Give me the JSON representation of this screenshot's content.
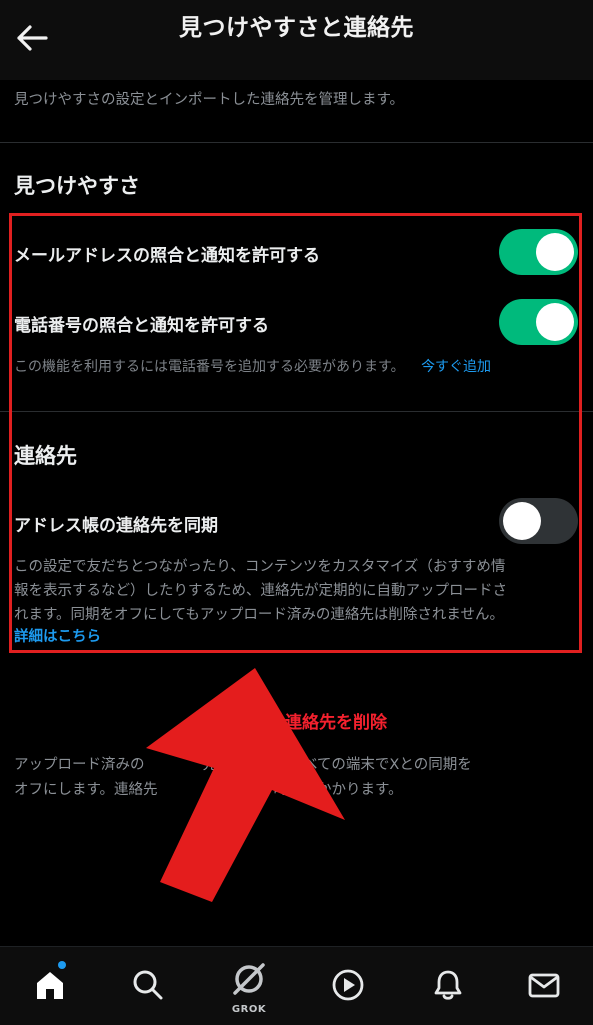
{
  "header": {
    "title": "見つけやすさと連絡先",
    "back_icon": "arrow-left-icon"
  },
  "intro": "見つけやすさの設定とインポートした連絡先を管理します。",
  "discoverability": {
    "heading": "見つけやすさ",
    "email_label": "メールアドレスの照合と通知を許可する",
    "email_enabled": true,
    "phone_label": "電話番号の照合と通知を許可する",
    "phone_enabled": true,
    "phone_note": "この機能を利用するには電話番号を追加する必要があります。",
    "add_now_link": "今すぐ追加"
  },
  "contacts": {
    "heading": "連絡先",
    "sync_label": "アドレス帳の連絡先を同期",
    "sync_enabled": false,
    "sync_lines": [
      "この設定で友だちとつながったり、コンテンツをカスタマイズ（おすすめ情",
      "報を表示するなど）したりするため、連絡先が定期的に自動アップロードさ",
      "れます。同期をオフにしてもアップロード済みの連絡先は削除されません。"
    ],
    "details_link": "詳細はこちら",
    "delete_label_visible": "の連絡先を削除",
    "delete_desc_lines": [
      "アップロード済みの　　　　先を削除し、すべての端末でXとの同期を",
      "オフにします。連絡先　　　　しばらく時間がかかります。"
    ]
  },
  "bottom_nav": {
    "items": [
      "home-icon",
      "search-icon",
      "grok-icon",
      "video-play-icon",
      "bell-icon",
      "mail-icon"
    ],
    "grok_label": "GROK"
  },
  "colors": {
    "accent_blue": "#1d9bf0",
    "toggle_on": "#00ba7c",
    "highlight_red": "#e02020",
    "danger_red": "#f4212e"
  }
}
